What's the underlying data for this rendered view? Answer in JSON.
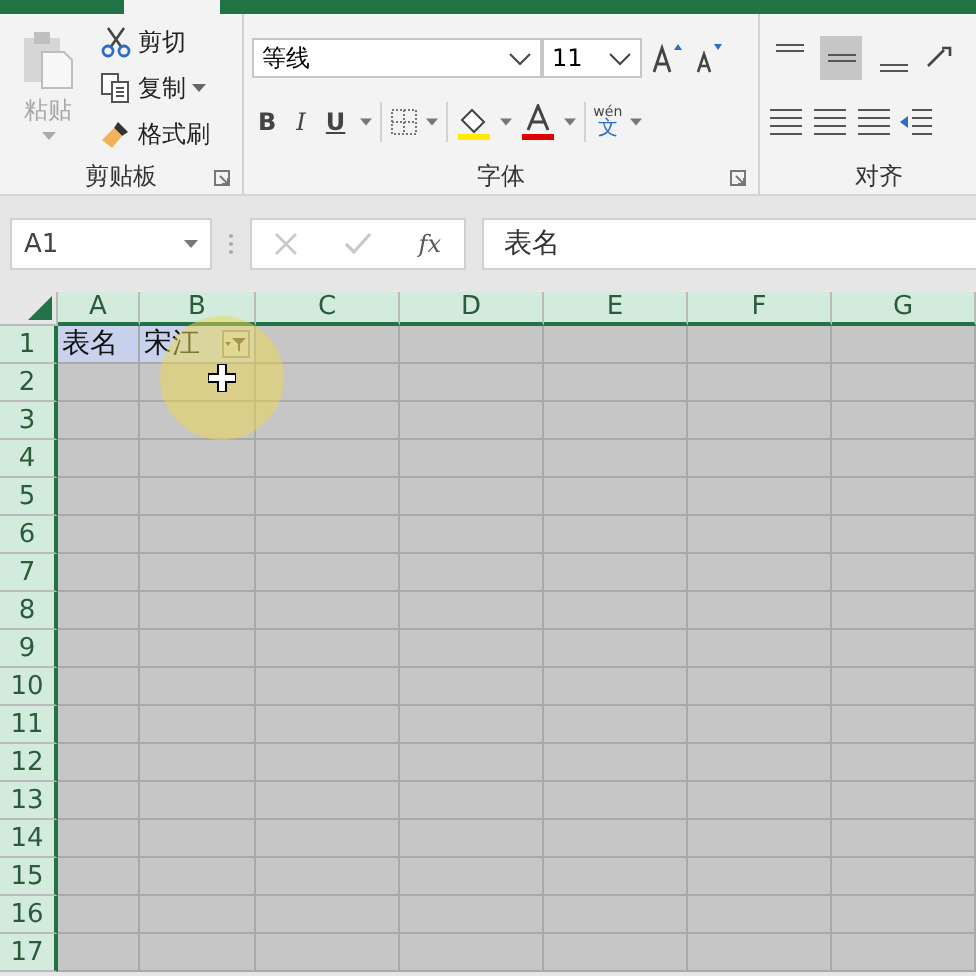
{
  "ribbon": {
    "groups": [
      {
        "kind": "clipboard",
        "label": "剪贴板",
        "paste": {
          "label": "粘贴",
          "disabled": true
        },
        "items": [
          {
            "label": "剪切",
            "kind": "cut"
          },
          {
            "label": "复制",
            "kind": "copy"
          },
          {
            "label": "格式刷",
            "kind": "painter"
          }
        ]
      },
      {
        "kind": "font",
        "label": "字体",
        "font_name": "等线",
        "font_size": "11",
        "styles": [
          "B",
          "I",
          "U"
        ],
        "phonetic": {
          "top": "wén",
          "bottom": "文"
        }
      },
      {
        "kind": "align",
        "label": "对齐",
        "vertical_align": [
          {
            "selected": false
          },
          {
            "selected": true
          },
          {
            "selected": false
          }
        ]
      }
    ]
  },
  "formula_bar": {
    "name_box": "A1",
    "fx": "fx",
    "value": "表名"
  },
  "sheet": {
    "all_selected": true,
    "columns": [
      "A",
      "B",
      "C",
      "D",
      "E",
      "F",
      "G"
    ],
    "rows": [
      {
        "label": "1",
        "cells": [
          {
            "text": "表名",
            "highlighted": true
          },
          {
            "text": "宋江",
            "highlighted": true,
            "filter": true
          }
        ]
      },
      {
        "label": "2"
      },
      {
        "label": "3"
      },
      {
        "label": "4"
      },
      {
        "label": "5"
      },
      {
        "label": "6"
      },
      {
        "label": "7"
      },
      {
        "label": "8"
      },
      {
        "label": "9"
      },
      {
        "label": "10"
      },
      {
        "label": "11"
      },
      {
        "label": "12"
      },
      {
        "label": "13"
      },
      {
        "label": "14"
      },
      {
        "label": "15"
      },
      {
        "label": "16"
      },
      {
        "label": "17"
      }
    ]
  }
}
